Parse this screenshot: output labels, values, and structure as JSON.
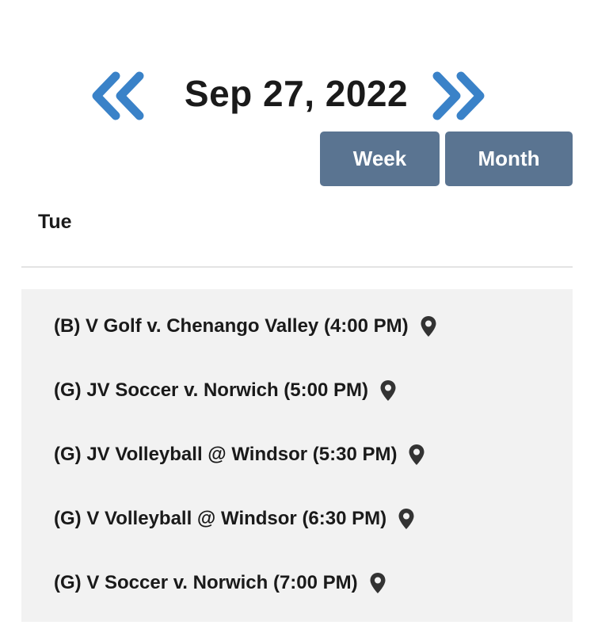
{
  "date_nav": {
    "date": "Sep 27, 2022",
    "prev_icon": "double-chevron-left-icon",
    "next_icon": "double-chevron-right-icon",
    "arrow_color": "#3a82c8"
  },
  "view_toggle": {
    "week_label": "Week",
    "month_label": "Month",
    "button_color": "#5a7491"
  },
  "day": {
    "label": "Tue"
  },
  "events": [
    {
      "text": "(B) V Golf v. Chenango Valley (4:00 PM)",
      "icon": "map-pin-icon"
    },
    {
      "text": "(G) JV Soccer v. Norwich (5:00 PM)",
      "icon": "map-pin-icon"
    },
    {
      "text": "(G) JV Volleyball @ Windsor (5:30 PM)",
      "icon": "map-pin-icon"
    },
    {
      "text": "(G) V Volleyball @ Windsor (6:30 PM)",
      "icon": "map-pin-icon"
    },
    {
      "text": "(G) V Soccer v. Norwich (7:00 PM)",
      "icon": "map-pin-icon"
    }
  ]
}
